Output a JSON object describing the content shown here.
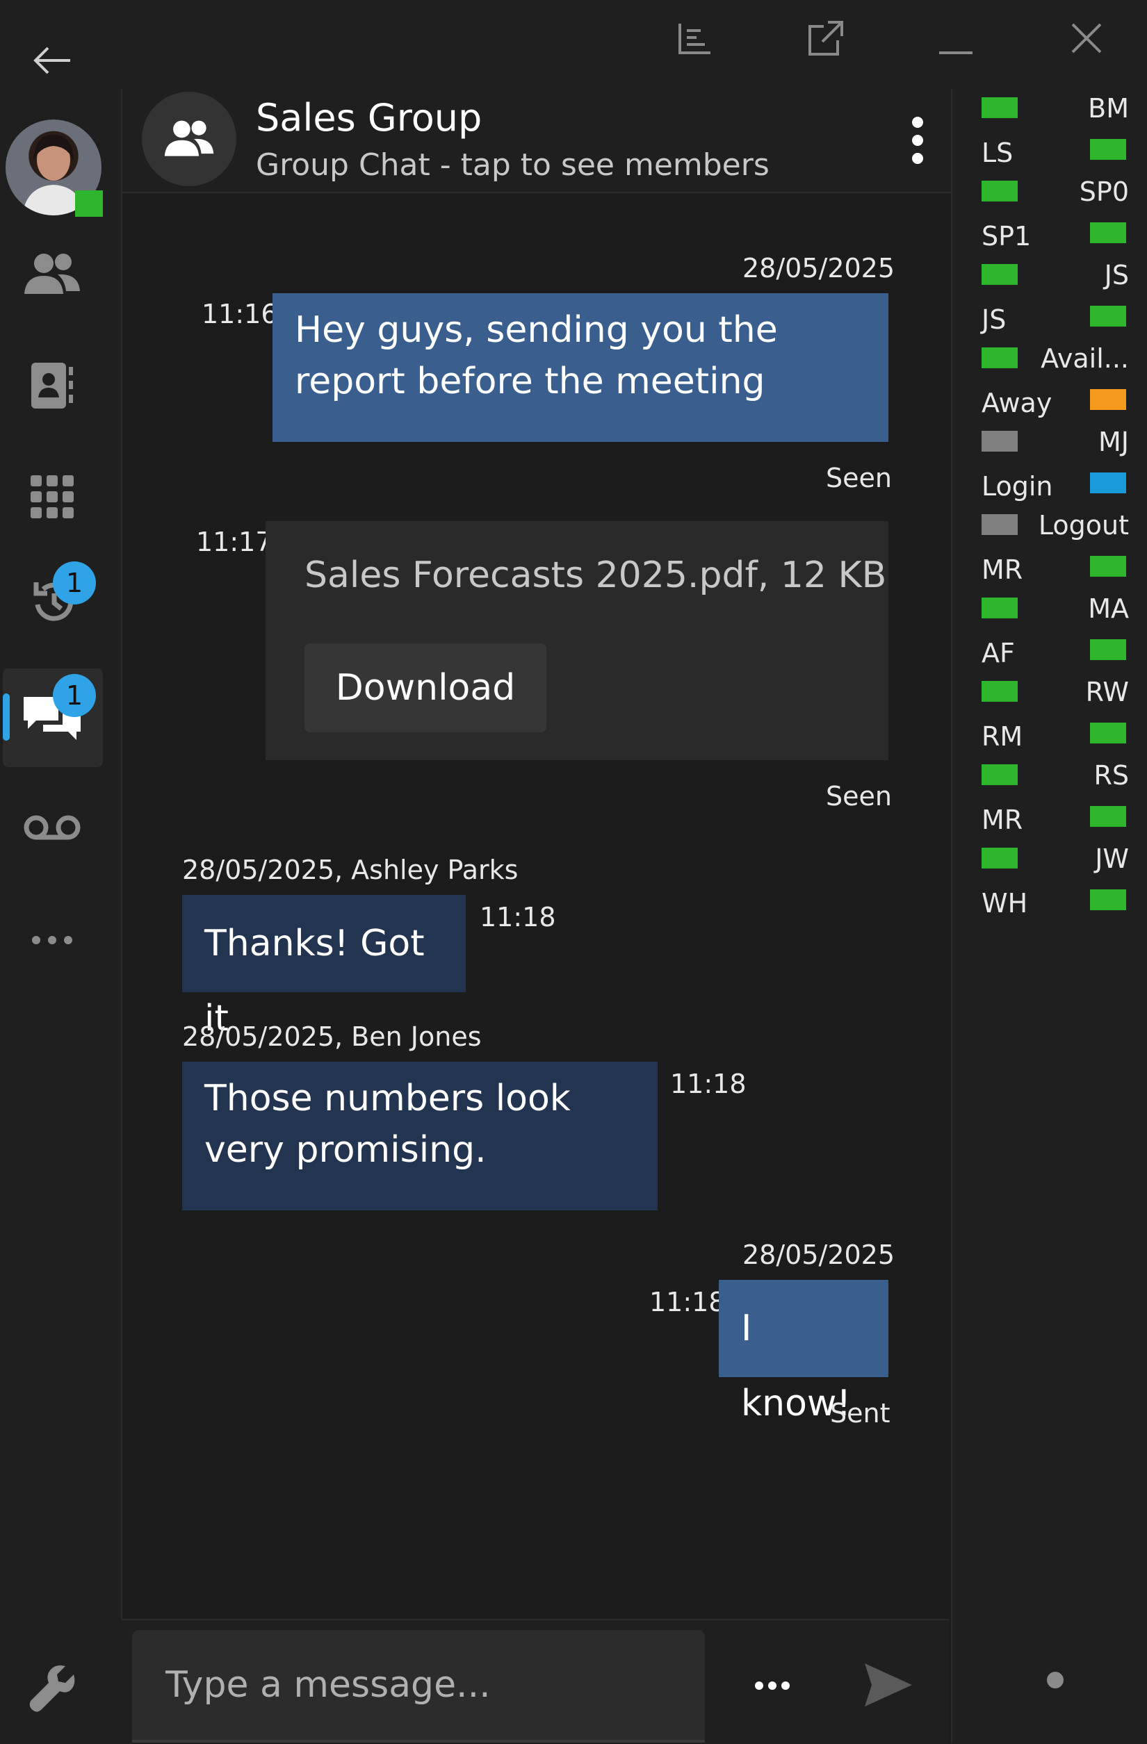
{
  "window": {
    "icons": [
      "back-arrow-icon",
      "layout-icon",
      "pop-out-icon",
      "minimize-icon",
      "close-icon"
    ]
  },
  "user": {
    "status_color": "#2db52d"
  },
  "nav": {
    "items": [
      {
        "name": "contacts",
        "icon": "people-icon"
      },
      {
        "name": "address-book",
        "icon": "address-book-icon"
      },
      {
        "name": "dialpad",
        "icon": "dialpad-icon"
      },
      {
        "name": "history",
        "icon": "history-icon",
        "badge": "1"
      },
      {
        "name": "chat",
        "icon": "chat-icon",
        "badge": "1",
        "active": true
      },
      {
        "name": "voicemail",
        "icon": "voicemail-icon"
      },
      {
        "name": "more",
        "icon": "more-icon"
      }
    ],
    "settings_icon": "wrench-icon"
  },
  "chat": {
    "title": "Sales Group",
    "subtitle": "Group Chat - tap to see members",
    "messages": {
      "m1": {
        "date": "28/05/2025",
        "time": "11:16",
        "text": "Hey guys, sending you the report before the meeting",
        "status": "Seen"
      },
      "m2": {
        "time": "11:17",
        "file": "Sales Forecasts 2025.pdf, 12 KB",
        "button": "Download",
        "status": "Seen"
      },
      "m3": {
        "meta": "28/05/2025, Ashley Parks",
        "time": "11:18",
        "text": "Thanks! Got it"
      },
      "m4": {
        "meta": "28/05/2025, Ben Jones",
        "time": "11:18",
        "text": "Those numbers look very promising."
      },
      "m5": {
        "date": "28/05/2025",
        "time": "11:18",
        "text": "I know!",
        "status": "Sent"
      }
    }
  },
  "composer": {
    "placeholder": "Type a message..."
  },
  "presence": [
    {
      "label": "BM",
      "color": "#2db52d"
    },
    {
      "label": "LS",
      "color": "#2db52d"
    },
    {
      "label": "SP0",
      "color": "#2db52d"
    },
    {
      "label": "SP1",
      "color": "#2db52d"
    },
    {
      "label": "JS",
      "color": "#2db52d"
    },
    {
      "label": "JS",
      "color": "#2db52d"
    },
    {
      "label": "Avail...",
      "color": "#2db52d"
    },
    {
      "label": "Away",
      "color": "#f59a1a"
    },
    {
      "label": "MJ",
      "color": "#808080"
    },
    {
      "label": "Login",
      "color": "#1a9ad8"
    },
    {
      "label": "Logout",
      "color": "#808080"
    },
    {
      "label": "MR",
      "color": "#2db52d"
    },
    {
      "label": "MA",
      "color": "#2db52d"
    },
    {
      "label": "AF",
      "color": "#2db52d"
    },
    {
      "label": "RW",
      "color": "#2db52d"
    },
    {
      "label": "RM",
      "color": "#2db52d"
    },
    {
      "label": "RS",
      "color": "#2db52d"
    },
    {
      "label": "MR",
      "color": "#2db52d"
    },
    {
      "label": "JW",
      "color": "#2db52d"
    },
    {
      "label": "WH",
      "color": "#2db52d"
    }
  ]
}
